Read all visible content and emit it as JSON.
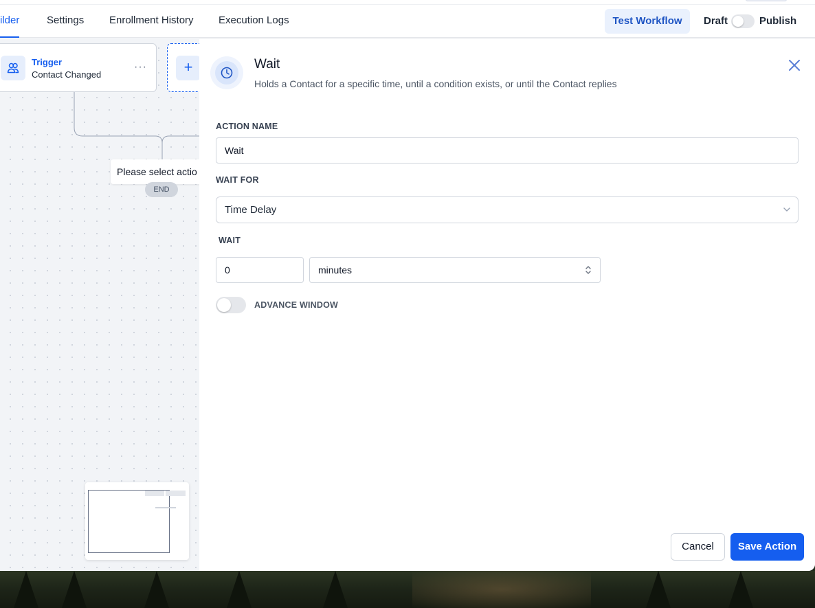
{
  "header": {
    "tabs": [
      {
        "label": "ilder",
        "active": true
      },
      {
        "label": "Settings",
        "active": false
      },
      {
        "label": "Enrollment History",
        "active": false
      },
      {
        "label": "Execution Logs",
        "active": false
      }
    ],
    "test_button": "Test Workflow",
    "status_draft": "Draft",
    "status_publish": "Publish",
    "publish_toggle_on": false
  },
  "canvas": {
    "trigger": {
      "title": "Trigger",
      "subtitle": "Contact Changed",
      "icon": "users-icon",
      "more": "···"
    },
    "add_button": "+",
    "tooltip": "Please select actio",
    "end_label": "END"
  },
  "panel": {
    "title": "Wait",
    "description": "Holds a Contact for a specific time, until a condition exists, or until the Contact replies",
    "icon": "clock-icon",
    "action_name_label": "ACTION NAME",
    "action_name_value": "Wait",
    "wait_for_label": "WAIT FOR",
    "wait_for_value": "Time Delay",
    "wait_label": "WAIT",
    "wait_amount": "0",
    "wait_unit": "minutes",
    "advance_window_label": "ADVANCE WINDOW",
    "advance_window_on": false,
    "cancel_label": "Cancel",
    "save_label": "Save Action"
  },
  "colors": {
    "accent": "#155eef",
    "accent_soft": "#eaf1fd",
    "canvas_bg": "#f2f4f7"
  }
}
